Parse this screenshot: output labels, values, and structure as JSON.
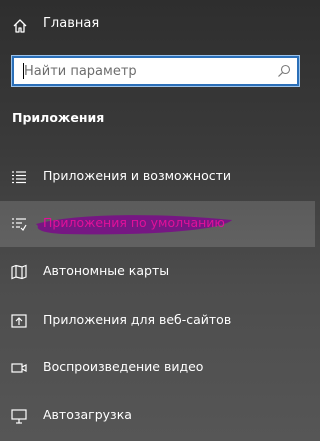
{
  "home": {
    "label": "Главная",
    "icon": "home-icon"
  },
  "search": {
    "placeholder": "Найти параметр",
    "value": "",
    "icon": "search-icon"
  },
  "section": {
    "title": "Приложения"
  },
  "nav": {
    "items": [
      {
        "label": "Приложения и возможности",
        "icon": "apps-list-icon"
      },
      {
        "label": "Приложения по умолчанию",
        "icon": "default-apps-icon",
        "selected": true
      },
      {
        "label": "Автономные карты",
        "icon": "map-icon"
      },
      {
        "label": "Приложения для веб-сайтов",
        "icon": "open-web-icon"
      },
      {
        "label": "Воспроизведение видео",
        "icon": "video-icon"
      },
      {
        "label": "Автозагрузка",
        "icon": "startup-icon"
      }
    ]
  },
  "colors": {
    "accent_border": "#2b6fb8",
    "highlight_marker": "#7a0a8a",
    "selected_text": "#e0109a"
  }
}
